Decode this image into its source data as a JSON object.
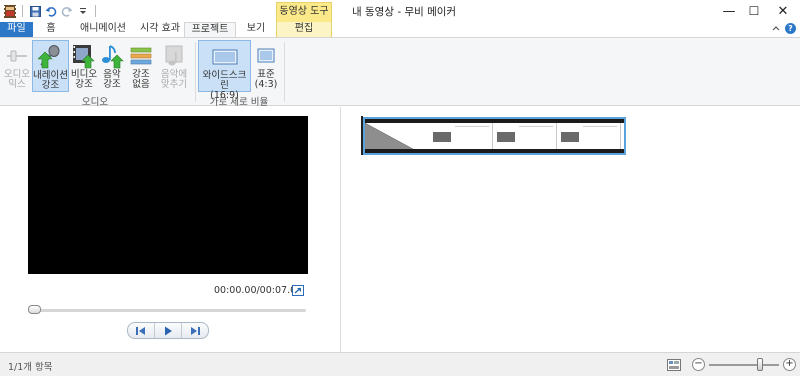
{
  "app": {
    "title": "내 동영상 - 무비 메이커",
    "context_tab_group": "동영상 도구"
  },
  "window_controls": {
    "minimize": "—",
    "maximize": "☐",
    "close": "✕"
  },
  "tabs": [
    {
      "label": "파일"
    },
    {
      "label": "홈"
    },
    {
      "label": "애니메이션"
    },
    {
      "label": "시각 효과"
    },
    {
      "label": "프로젝트"
    },
    {
      "label": "보기"
    },
    {
      "label": "편집"
    }
  ],
  "ribbon": {
    "audio_group": {
      "label": "오디오",
      "buttons": [
        {
          "label1": "오디오",
          "label2": "믹스",
          "icon": "audio-mix-icon",
          "state": "disabled"
        },
        {
          "label1": "내레이션",
          "label2": "강조",
          "icon": "narration-emphasis-icon",
          "state": "selected"
        },
        {
          "label1": "비디오",
          "label2": "강조",
          "icon": "video-emphasis-icon",
          "state": "normal"
        },
        {
          "label1": "음악",
          "label2": "강조",
          "icon": "music-emphasis-icon",
          "state": "normal"
        },
        {
          "label1": "강조",
          "label2": "없음",
          "icon": "no-emphasis-icon",
          "state": "normal"
        },
        {
          "label1": "음악에",
          "label2": "맞추기",
          "icon": "fit-to-music-icon",
          "state": "disabled"
        }
      ]
    },
    "aspect_group": {
      "label": "가로 세로 비율",
      "buttons": [
        {
          "label1": "와이드스크린",
          "label2": "(16:9)",
          "icon": "widescreen-icon",
          "state": "selected"
        },
        {
          "label1": "표준",
          "label2": "(4:3)",
          "icon": "standard-icon",
          "state": "normal"
        }
      ]
    }
  },
  "preview": {
    "timecode": "00:00.00/00:07.00",
    "progress": 0
  },
  "status": {
    "items_text": "1/1개 항목",
    "zoom_level": 0.7
  },
  "colors": {
    "file_tab": "#2b78c8",
    "context_tab": "#fbe98a",
    "selection": "#c9e0f7",
    "clip_border": "#5aa2dc"
  }
}
